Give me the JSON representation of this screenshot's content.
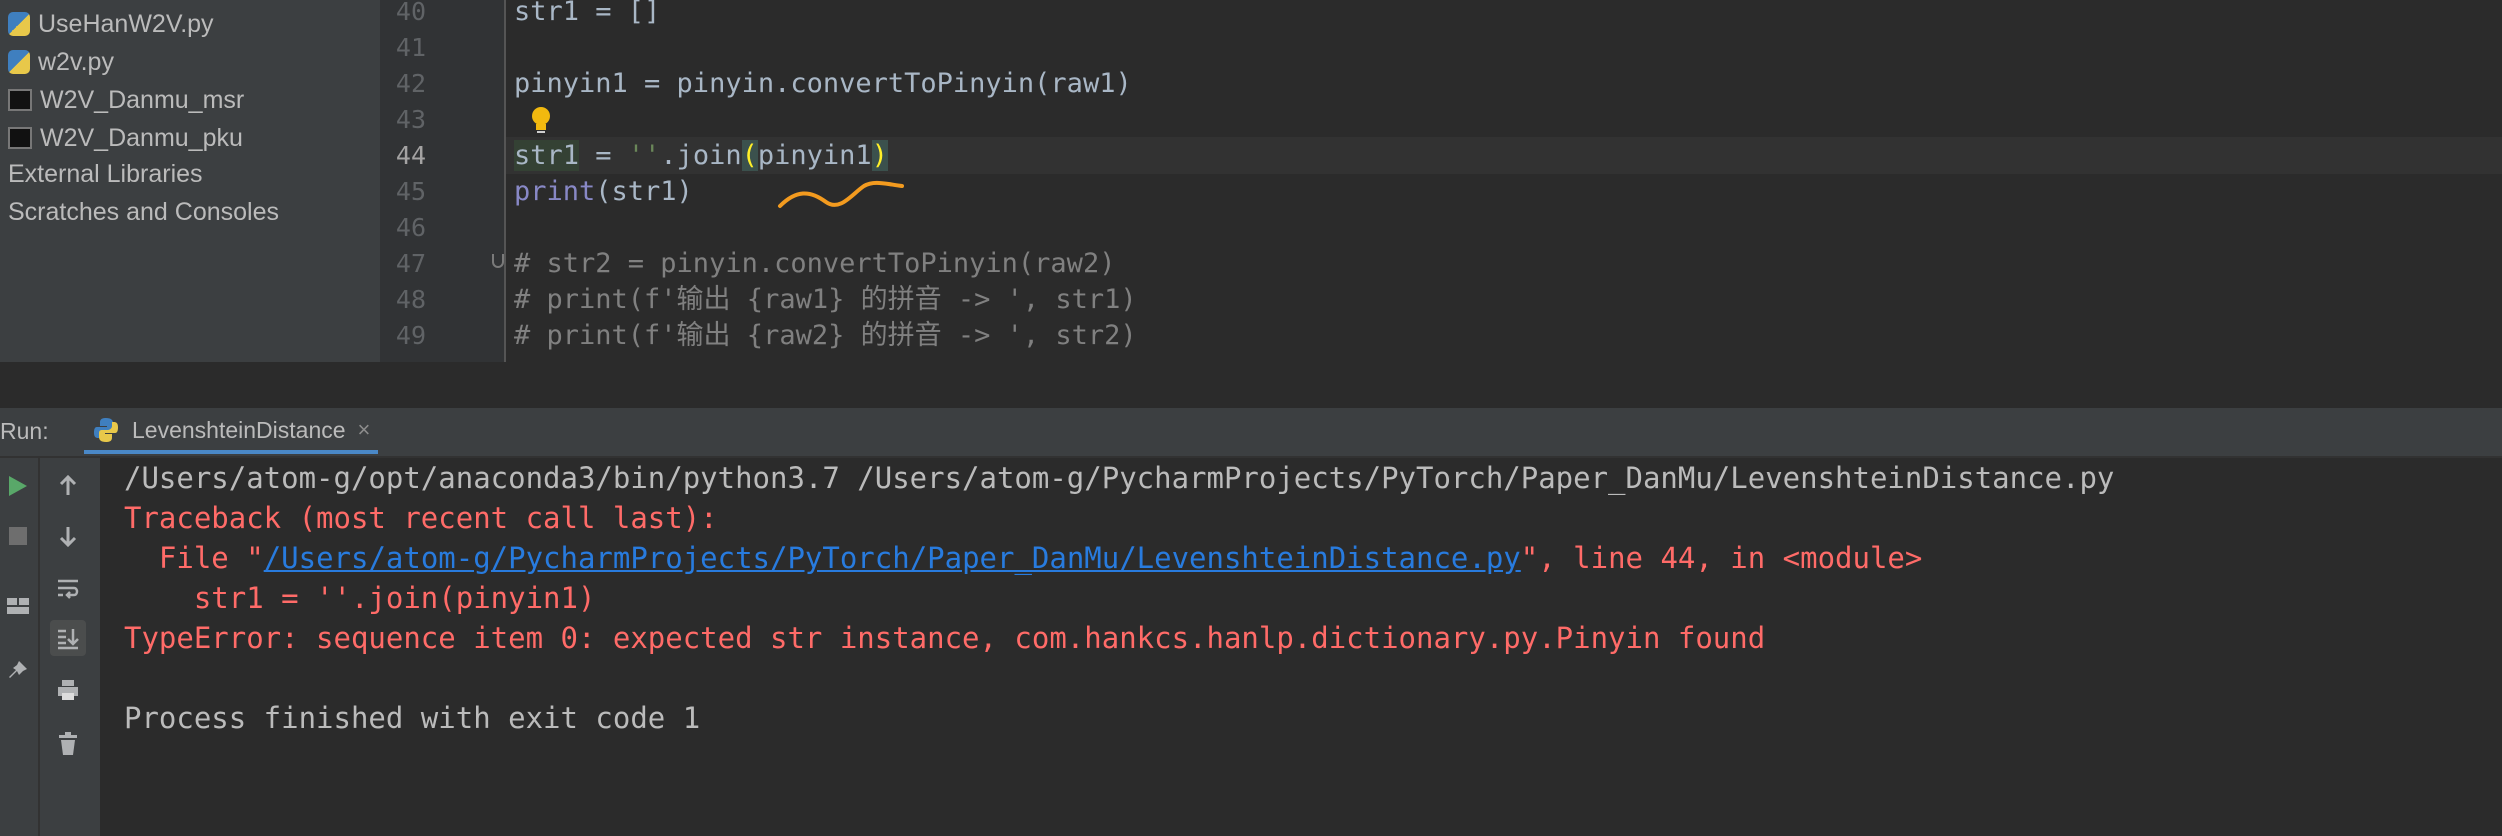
{
  "project_tree": {
    "items": [
      {
        "label": "UseHanW2V.py"
      },
      {
        "label": "w2v.py"
      },
      {
        "label": "W2V_Danmu_msr"
      },
      {
        "label": "W2V_Danmu_pku"
      },
      {
        "label": "External Libraries"
      },
      {
        "label": "Scratches and Consoles"
      }
    ]
  },
  "editor": {
    "line_numbers": [
      "40",
      "41",
      "42",
      "43",
      "44",
      "45",
      "46",
      "47",
      "48",
      "49"
    ],
    "lines": [
      "str1 = []",
      "",
      "pinyin1 = pinyin.convertToPinyin(raw1)",
      "",
      "str1 = ''.join(pinyin1)",
      "print(str1)",
      "",
      "# str2 = pinyin.convertToPinyin(raw2)",
      "# print(f'输出 {raw1} 的拼音 -> ', str1)",
      "# print(f'输出 {raw2} 的拼音 -> ', str2)"
    ],
    "active_line": "44"
  },
  "run_panel": {
    "label": "Run:",
    "tab_label": "LevenshteinDistance",
    "tab_close": "×"
  },
  "console": {
    "command": "/Users/atom-g/opt/anaconda3/bin/python3.7 /Users/atom-g/PycharmProjects/PyTorch/Paper_DanMu/LevenshteinDistance.py",
    "traceback_header": "Traceback (most recent call last):",
    "file_prefix": "  File \"",
    "file_path": "/Users/atom-g/PycharmProjects/PyTorch/Paper_DanMu/LevenshteinDistance.py",
    "file_suffix": "\", line 44, in <module>",
    "code_line": "    str1 = ''.join(pinyin1)",
    "error": "TypeError: sequence item 0: expected str instance, com.hankcs.hanlp.dictionary.py.Pinyin found",
    "exit_message": "Process finished with exit code 1"
  },
  "colors": {
    "editor_bg": "#2b2b2b",
    "panel_bg": "#3c3f41",
    "error_text": "#ff6b68",
    "link": "#287bde",
    "annotation_scribble": "#f39b1f"
  },
  "icons": [
    "python-file-icon",
    "directory-icon",
    "lightbulb-icon",
    "fold-icon",
    "run-icon",
    "stop-icon",
    "arrow-up-icon",
    "arrow-down-icon",
    "soft-wrap-icon",
    "scroll-to-end-icon",
    "layout-icon",
    "pin-icon",
    "print-icon",
    "trash-icon",
    "close-icon"
  ]
}
